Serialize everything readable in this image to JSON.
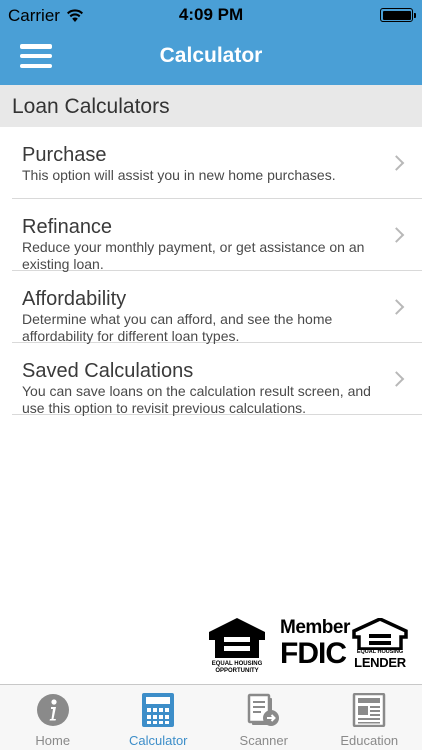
{
  "status_bar": {
    "carrier": "Carrier",
    "time": "4:09 PM"
  },
  "nav": {
    "title": "Calculator",
    "menu_icon": "hamburger-menu-icon"
  },
  "section": {
    "title": "Loan Calculators"
  },
  "items": [
    {
      "title": "Purchase",
      "description": "This option will assist you in new home purchases."
    },
    {
      "title": "Refinance",
      "description": "Reduce your monthly payment, or get assistance on an existing loan."
    },
    {
      "title": "Affordability",
      "description": "Determine what you can afford, and see the home affordability for different loan types."
    },
    {
      "title": "Saved Calculations",
      "description": "You can save loans on the calculation result screen, and use this option to revisit previous calculations."
    }
  ],
  "logos": {
    "equal_housing_opportunity": "EQUAL HOUSING OPPORTUNITY",
    "fdic_member": "Member",
    "fdic_name": "FDIC",
    "lender_small": "EQUAL HOUSING",
    "lender_big": "LENDER"
  },
  "tabs": [
    {
      "label": "Home",
      "icon": "info-icon"
    },
    {
      "label": "Calculator",
      "icon": "calculator-icon",
      "active": true
    },
    {
      "label": "Scanner",
      "icon": "scanner-icon"
    },
    {
      "label": "Education",
      "icon": "newspaper-icon"
    }
  ],
  "colors": {
    "brand_blue": "#4a9fd6",
    "active_tab": "#3d8ec9",
    "inactive_tab": "#8a8a8a"
  }
}
